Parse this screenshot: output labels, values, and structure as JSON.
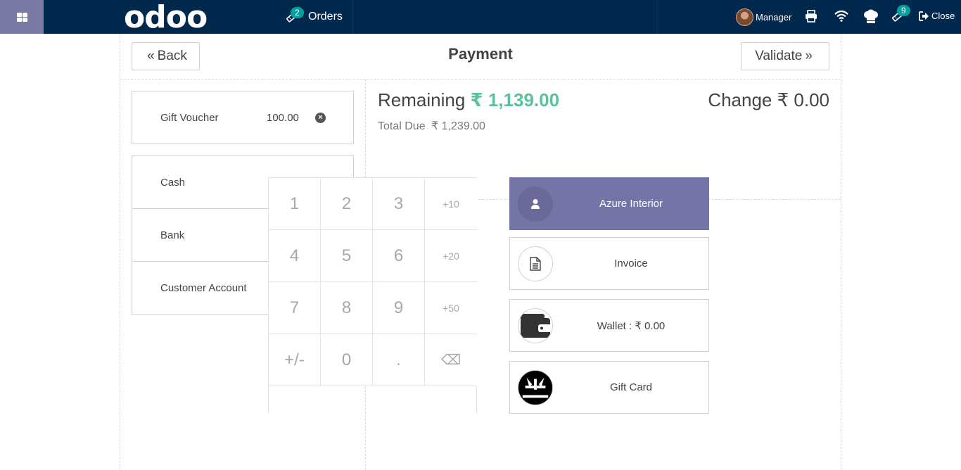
{
  "topbar": {
    "logo": "odoo",
    "orders_label": "Orders",
    "orders_count": "2",
    "user_name": "Manager",
    "sync_count": "9",
    "close_label": "Close"
  },
  "header": {
    "back_label": "Back",
    "title": "Payment",
    "validate_label": "Validate"
  },
  "paymentlines": [
    {
      "name": "Gift Voucher",
      "amount": "100.00"
    }
  ],
  "methods": [
    {
      "label": "Cash"
    },
    {
      "label": "Bank"
    },
    {
      "label": "Customer Account"
    }
  ],
  "summary": {
    "remaining_label": "Remaining",
    "remaining_value": "₹ 1,139.00",
    "change_label": "Change",
    "change_value": "₹ 0.00",
    "total_due_label": "Total Due",
    "total_due_value": "₹ 1,239.00"
  },
  "numpad": {
    "keys": [
      "1",
      "2",
      "3",
      "+10",
      "4",
      "5",
      "6",
      "+20",
      "7",
      "8",
      "9",
      "+50",
      "+/-",
      "0",
      ".",
      "⌫"
    ]
  },
  "side_buttons": {
    "customer": "Azure Interior",
    "invoice": "Invoice",
    "wallet": "Wallet : ₹ 0.00",
    "gift_card": "Gift Card"
  },
  "colors": {
    "topbar": "#01284d",
    "accent": "#7574a7",
    "remaining": "#5dc19a",
    "badge": "#00a09d"
  }
}
